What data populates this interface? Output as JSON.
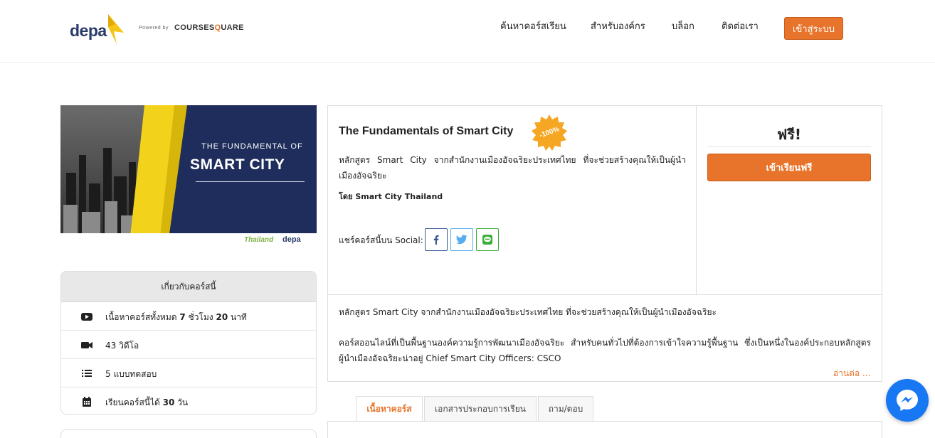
{
  "header": {
    "logo_text": "depa",
    "powered_by": "Powered by",
    "powered_brand_a": "COURSES",
    "powered_brand_b": "Q",
    "powered_brand_c": "UARE",
    "nav": [
      "ค้นหาคอร์สเรียน",
      "สำหรับองค์กร",
      "บล็อก",
      "ติดต่อเรา"
    ],
    "login_label": "เข้าสู่ระบบ"
  },
  "banner": {
    "title_small": "THE FUNDAMENTAL OF",
    "title_big": "SMART CITY",
    "foot_1": "Thailand",
    "foot_2": "depa"
  },
  "about": {
    "heading": "เกี่ยวกับคอร์สนี้",
    "rows": [
      {
        "icon": "youtube-icon",
        "prefix": "เนื้อหาคอร์สทั้งหมด ",
        "hours": "7",
        "mid": " ชั่วโมง ",
        "minutes": "20",
        "suffix": " นาที"
      },
      {
        "icon": "video-camera-icon",
        "text": "43 วิดีโอ"
      },
      {
        "icon": "list-icon",
        "text": "5 แบบทดสอบ"
      },
      {
        "icon": "calendar-icon",
        "prefix": "เรียนคอร์สนี้ได้ ",
        "days": "30",
        "suffix": " วัน"
      }
    ]
  },
  "course": {
    "title": "The Fundamentals of Smart City",
    "discount_badge": "-100%",
    "short_desc": "หลักสูตร Smart City จากสำนักงานเมืองอัจฉริยะประเทศไทย ที่จะช่วยสร้างคุณให้เป็นผู้นำเมืองอัจฉริยะ",
    "author": "โดย Smart City Thailand",
    "share_label": "แชร์คอร์สนี้บน Social:",
    "price": "ฟรี!",
    "enroll_label": "เข้าเรียนฟรี",
    "long_desc_1": "หลักสูตร Smart City จากสำนักงานเมืองอัจฉริยะประเทศไทย ที่จะช่วยสร้างคุณให้เป็นผู้นำเมืองอัจฉริยะ",
    "long_desc_2": "คอร์สออนไลน์ที่เป็นพื้นฐานองค์ความรู้การพัฒนาเมืองอัจฉริยะ สำหรับคนทั่วไปที่ต้องการเข้าใจความรู้พื้นฐาน ซึ่งเป็นหนึ่งในองค์ประกอบหลักสูตรผู้นำเมืองอัจฉริยะน่าอยู่ Chief Smart City Officers: CSCO",
    "read_more": "อ่านต่อ ..."
  },
  "tabs": [
    {
      "label": "เนื้อหาคอร์ส",
      "active": true
    },
    {
      "label": "เอกสารประกอบการเรียน",
      "active": false
    },
    {
      "label": "ถาม/ตอบ",
      "active": false
    }
  ],
  "colors": {
    "accent": "#e8732a",
    "brand_navy": "#1f2d5c",
    "messenger": "#1877f2",
    "badge": "#f5a623"
  }
}
